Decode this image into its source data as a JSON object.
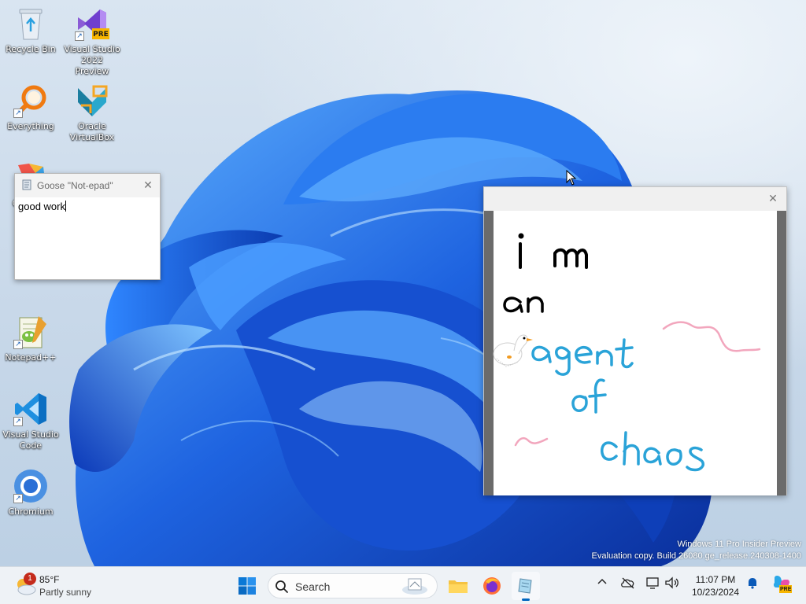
{
  "desktop": {
    "icons": [
      {
        "label_line1": "Recycle Bin",
        "label_line2": ""
      },
      {
        "label_line1": "Visual Studio",
        "label_line2": "2022 Preview",
        "badge": "PRE"
      },
      {
        "label_line1": "Everything",
        "label_line2": ""
      },
      {
        "label_line1": "Oracle",
        "label_line2": "VirtualBox"
      },
      {
        "label_line1": "Git Bash",
        "label_line2": ""
      },
      {
        "label_line1": "Notepad++",
        "label_line2": ""
      },
      {
        "label_line1": "Visual Studio",
        "label_line2": "Code"
      },
      {
        "label_line1": "Chromium",
        "label_line2": ""
      }
    ],
    "watermark_line1": "Windows 11 Pro Insider Preview",
    "watermark_line2": "Evaluation copy. Build 26080.ge_release.240308-1400"
  },
  "notepad_window": {
    "title": "Goose \"Not-epad\"",
    "content": "good work",
    "close_glyph": "✕"
  },
  "drawing_window": {
    "close_glyph": "✕",
    "drawn_text_black": [
      "i m",
      "an"
    ],
    "drawn_text_blue": [
      "agent",
      "of",
      "chaos"
    ]
  },
  "taskbar": {
    "weather_temp": "85°F",
    "weather_condition": "Partly sunny",
    "weather_badge": "1",
    "search_placeholder": "Search",
    "clock_time": "11:07 PM",
    "clock_date": "10/23/2024",
    "copilot_badge": "PRE"
  },
  "colors": {
    "accent": "#0067c0",
    "wallpaper_blue": "#1a5fd8",
    "ink_black": "#000000",
    "ink_blue": "#2aa3d8",
    "ink_pink": "#f0a0b8"
  }
}
